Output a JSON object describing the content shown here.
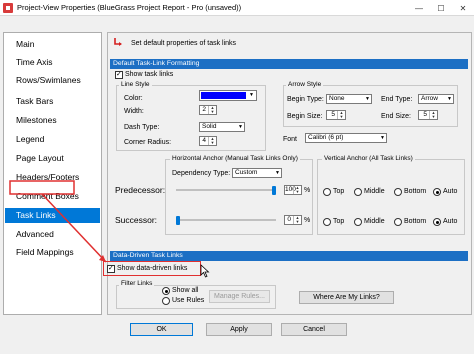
{
  "window": {
    "title": "Project-View Properties (BlueGrass Project Report - Pro (unsaved))",
    "controls": [
      "—",
      "☐",
      "✕"
    ]
  },
  "nav": {
    "items": [
      {
        "label": "Main"
      },
      {
        "label": "Time Axis"
      },
      {
        "label": "Rows/Swimlanes"
      },
      {
        "label": "Task Bars"
      },
      {
        "label": "Milestones"
      },
      {
        "label": "Legend"
      },
      {
        "label": "Page Layout"
      },
      {
        "label": "Headers/Footers"
      },
      {
        "label": "Comment Boxes"
      },
      {
        "label": "Task Links"
      },
      {
        "label": "Advanced"
      },
      {
        "label": "Field Mappings"
      }
    ],
    "selected": "Task Links"
  },
  "header": {
    "text": "Set default properties of task links"
  },
  "default_section": {
    "title": "Default Task-Link Formatting",
    "show_task_links": {
      "label": "Show task links",
      "checked": true
    },
    "line_style": {
      "title": "Line Style",
      "color_label": "Color:",
      "color_value": "#0000ff",
      "width_label": "Width:",
      "width_value": "2",
      "dash_label": "Dash Type:",
      "dash_value": "Solid",
      "radius_label": "Corner Radius:",
      "radius_value": "4"
    },
    "arrow_style": {
      "title": "Arrow Style",
      "begin_type_label": "Begin Type:",
      "begin_type_value": "None",
      "end_type_label": "End Type:",
      "end_type_value": "Arrow",
      "begin_size_label": "Begin Size:",
      "begin_size_value": "5",
      "end_size_label": "End Size:",
      "end_size_value": "5"
    },
    "font": {
      "label": "Font",
      "value": "Calibri (6 pt)"
    },
    "horizontal_anchor": {
      "title": "Horizontal Anchor (Manual Task Links Only)",
      "dependency_label": "Dependency Type:",
      "dependency_value": "Custom",
      "predecessor_label": "Predecessor:",
      "predecessor_value": "100",
      "predecessor_level": 1.0,
      "successor_label": "Successor:",
      "successor_value": "0",
      "successor_level": 0.0,
      "percent": "%"
    },
    "vertical_anchor": {
      "title": "Vertical Anchor (All Task Links)",
      "options": [
        "Top",
        "Middle",
        "Bottom",
        "Auto"
      ],
      "predecessor_selected": "Auto",
      "successor_selected": "Auto"
    }
  },
  "data_driven_section": {
    "title": "Data-Driven Task Links",
    "show_data_driven": {
      "label": "Show data-driven links",
      "checked": true
    },
    "filter_links": {
      "title": "Filter Links",
      "show_all_label": "Show all",
      "use_rules_label": "Use Rules",
      "selected": "Show all",
      "manage_rules_label": "Manage Rules..."
    },
    "where_button_label": "Where Are My Links?"
  },
  "footer": {
    "ok_label": "OK",
    "apply_label": "Apply",
    "cancel_label": "Cancel"
  },
  "colors": {
    "accent": "#0078d7",
    "section_bar": "#1c6fc4",
    "callout": "#e03030"
  }
}
